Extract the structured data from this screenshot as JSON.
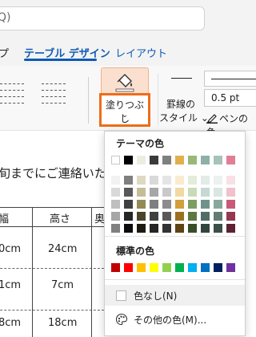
{
  "search": {
    "text": "Q)"
  },
  "tabs": [
    {
      "label": "プ"
    },
    {
      "label": "テーブル デザイン",
      "active": true
    },
    {
      "label": "レイアウト"
    }
  ],
  "ribbon": {
    "shading_button": {
      "label": "塗りつぶし",
      "caret": "⌄"
    },
    "borders": {
      "border_styles_label_line1": "罫線の",
      "border_styles_label_line2": "スタイル ⌄",
      "pen_weight": "0.5 pt",
      "pen_color_label": "ペンの色"
    }
  },
  "document": {
    "text": "旬までにご連絡いたし",
    "table": {
      "headers": [
        "幅",
        "高さ",
        "奥"
      ],
      "rows": [
        [
          "0cm",
          "24cm"
        ],
        [
          "1cm",
          "7cm"
        ],
        [
          "8cm",
          "18cm"
        ]
      ]
    }
  },
  "shading_menu": {
    "theme_colors_title": "テーマの色",
    "theme_colors": {
      "columns": [
        [
          "#ffffff",
          "#f2f2f2",
          "#d9d9d9",
          "#bfbfbf",
          "#a6a6a6",
          "#808080"
        ],
        [
          "#000000",
          "#7f7f7f",
          "#595959",
          "#404040",
          "#262626",
          "#0d0d0d"
        ],
        [
          "#eeece1",
          "#ddd9c3",
          "#c4bd97",
          "#948a54",
          "#4a452a",
          "#1d1b10"
        ],
        [
          "#3a3a3a",
          "#d9d9d9",
          "#a6a6a6",
          "#7f7f7f",
          "#404040",
          "#262626"
        ],
        [
          "#7f7f7f",
          "#e5e5e5",
          "#c9c9c9",
          "#8c8c8c",
          "#595959",
          "#333333"
        ],
        [
          "#e0b04c",
          "#f8ecd0",
          "#f1d9a2",
          "#d39f3a",
          "#9b7020",
          "#5e4313"
        ],
        [
          "#98b87a",
          "#e3edd9",
          "#c9dbb6",
          "#7e9e5f",
          "#5c7842",
          "#3a4d29"
        ],
        [
          "#8fb0a6",
          "#e2ebe8",
          "#c6d8d3",
          "#6e948a",
          "#4f6d64",
          "#324640"
        ],
        [
          "#a7c3b8",
          "#ecf2f0",
          "#d9e6e1",
          "#87a89b",
          "#607d72",
          "#3c4f48"
        ],
        [
          "#de7f96",
          "#f8e0e6",
          "#f1c1cd",
          "#c9597a",
          "#94374f",
          "#5c2232"
        ]
      ]
    },
    "standard_colors_title": "標準の色",
    "standard_colors": [
      "#c00000",
      "#ff0000",
      "#ffc000",
      "#ffff00",
      "#92d050",
      "#00b050",
      "#00b0f0",
      "#0070c0",
      "#002060",
      "#7030a0"
    ],
    "no_color_label": "色なし(N)",
    "more_colors_label": "その他の色(M)...",
    "icons": {
      "no_color": "empty-square-icon",
      "more_colors": "palette-icon"
    }
  },
  "colors": {
    "highlight_outline": "#ef6c1a",
    "tab_accent": "#0f5ab4"
  }
}
